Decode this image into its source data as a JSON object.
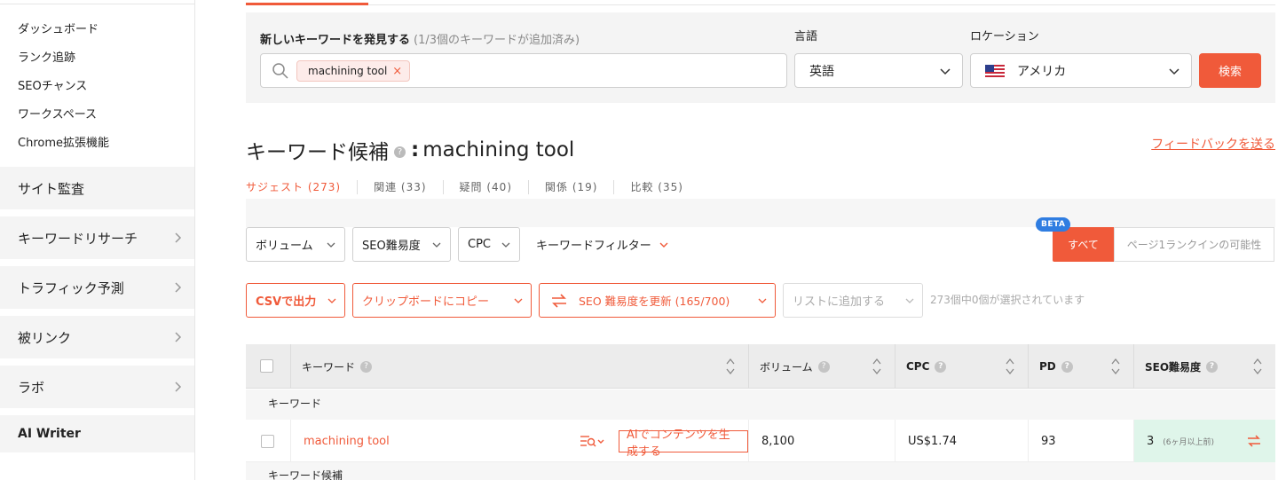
{
  "sidebar": {
    "sub_items": [
      "ダッシュボード",
      "ランク追跡",
      "SEOチャンス",
      "ワークスペース",
      "Chrome拡張機能"
    ],
    "sections": [
      "サイト監査",
      "キーワードリサーチ",
      "トラフィック予測",
      "被リンク",
      "ラボ",
      "AI Writer"
    ]
  },
  "search": {
    "label": "新しいキーワードを発見する",
    "note": "(1/3個のキーワードが追加済み)",
    "chip": "machining tool",
    "chip_remove": "×",
    "language_label": "言語",
    "language_value": "英語",
    "location_label": "ロケーション",
    "location_value": "アメリカ",
    "search_button": "検索"
  },
  "title": {
    "prefix": "キーワード候補",
    "help": "?",
    "colon": ":",
    "keyword": "machining tool"
  },
  "feedback_link": "フィードバックを送る",
  "subtabs": [
    "サジェスト (273)",
    "関連 (33)",
    "疑問 (40)",
    "関係 (19)",
    "比較 (35)"
  ],
  "filters": {
    "volume": "ボリューム",
    "seo_difficulty": "SEO難易度",
    "cpc": "CPC",
    "keyword_filter": "キーワードフィルター",
    "beta_badge": "BETA",
    "segment_all": "すべて",
    "segment_rank": "ページ1ランクインの可能性"
  },
  "actions": {
    "csv": "CSVで出力",
    "clipboard": "クリップボードにコピー",
    "seo_update": "SEO 難易度を更新 (165/700)",
    "add_to_list": "リストに追加する",
    "selection_status": "273個中0個が選択されています"
  },
  "table": {
    "headers": {
      "keyword": "キーワード",
      "volume": "ボリューム",
      "cpc": "CPC",
      "pd": "PD",
      "seo": "SEO難易度",
      "help": "?"
    },
    "group_keyword": "キーワード",
    "row": {
      "keyword": "machining tool",
      "ai_button": "AIでコンテンツを生成する",
      "volume": "8,100",
      "cpc": "US$1.74",
      "pd": "93",
      "seo": "3",
      "seo_note": "(6ヶ月以上前)"
    },
    "group_candidates": "キーワード候補"
  },
  "colors": {
    "accent": "#f05a3a",
    "beta": "#2f7de1",
    "seo_cell": "#dff5ea"
  }
}
